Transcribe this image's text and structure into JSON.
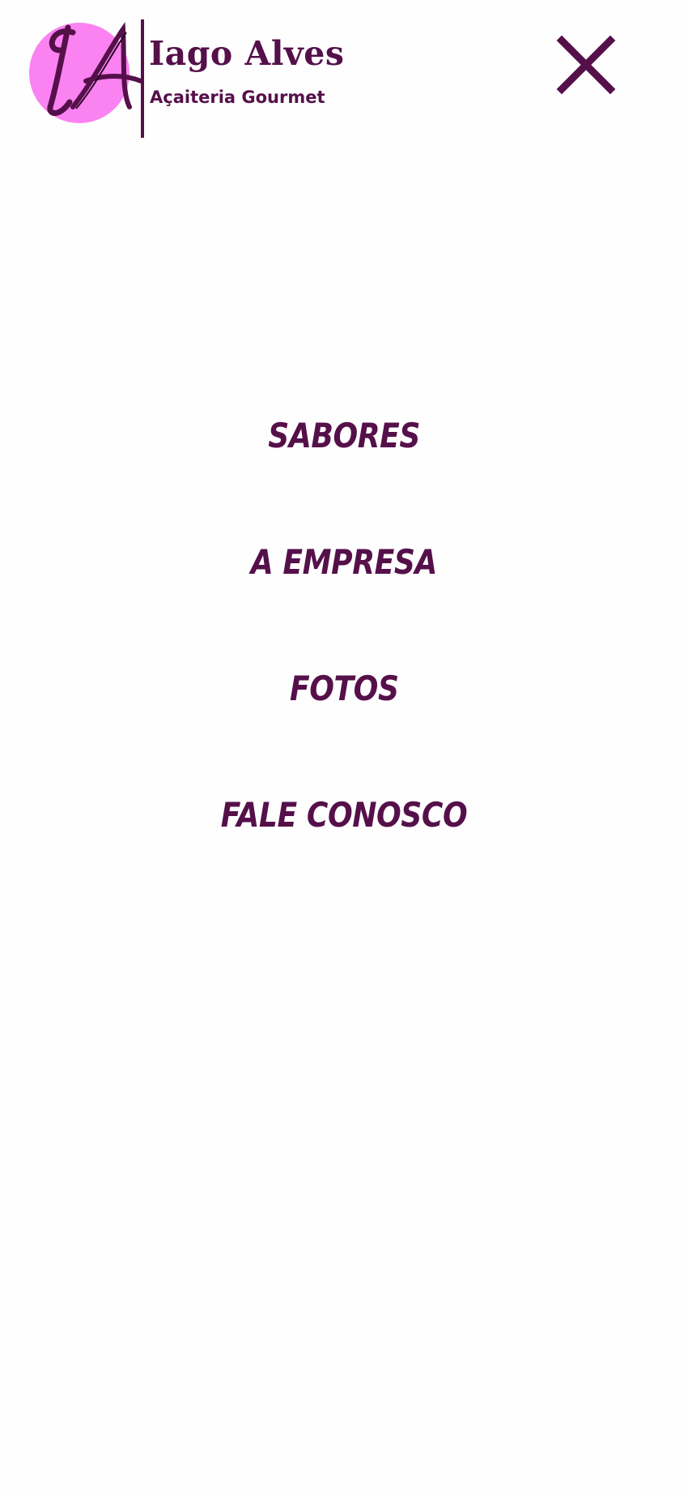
{
  "header": {
    "brand_name": "Iago Alves",
    "brand_tagline": "Açaiteria Gourmet",
    "logo_monogram": "IA",
    "logo_icon": "ia-monogram-logo",
    "close_icon": "close-icon"
  },
  "nav": {
    "items": [
      {
        "label": "SABORES"
      },
      {
        "label": "A EMPRESA"
      },
      {
        "label": "FOTOS"
      },
      {
        "label": "FALE CONOSCO"
      }
    ]
  },
  "colors": {
    "brand_purple": "#55104a",
    "logo_pink": "#fb82f1",
    "background": "#fefefe"
  }
}
